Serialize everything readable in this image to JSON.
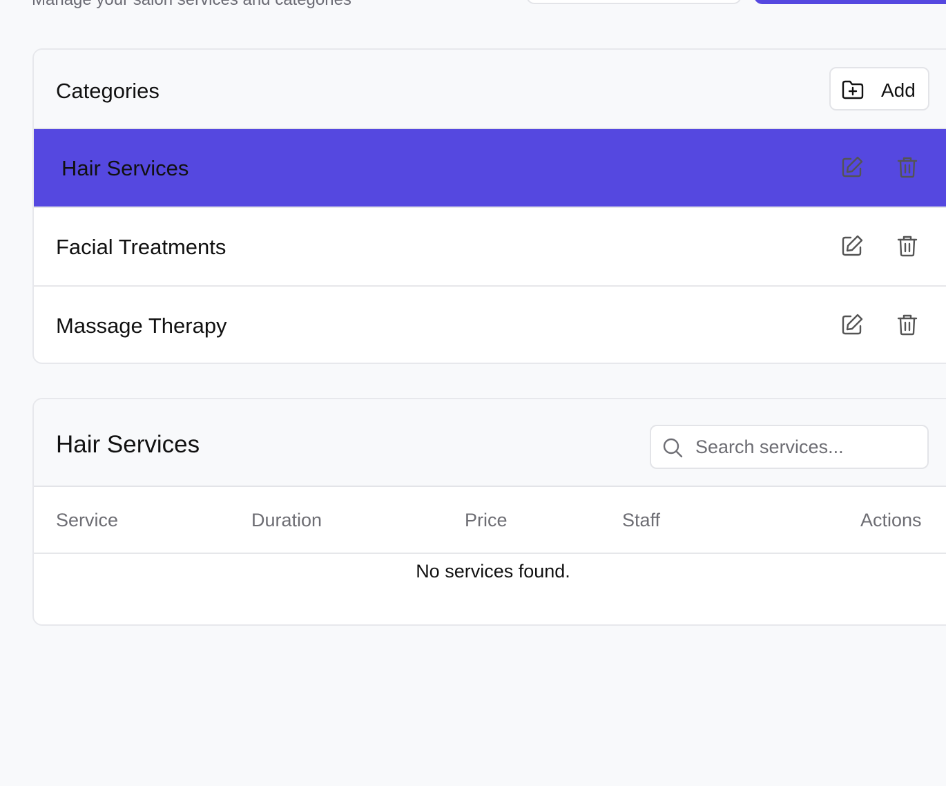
{
  "header": {
    "subtitle": "Manage your salon services and categories"
  },
  "colors": {
    "accent": "#5548e0",
    "icon_gray": "#545454",
    "muted_text": "#6d6d73"
  },
  "categories": {
    "title": "Categories",
    "add_label": "Add",
    "add_icon": "folder-plus-icon",
    "items": [
      {
        "label": "Hair Services",
        "selected": true
      },
      {
        "label": "Facial Treatments",
        "selected": false
      },
      {
        "label": "Massage Therapy",
        "selected": false
      }
    ],
    "edit_icon": "edit-icon",
    "delete_icon": "trash-icon"
  },
  "services": {
    "title": "Hair Services",
    "search_placeholder": "Search services...",
    "search_value": "",
    "columns": [
      "Service",
      "Duration",
      "Price",
      "Staff",
      "Actions"
    ],
    "empty_message": "No services found."
  }
}
